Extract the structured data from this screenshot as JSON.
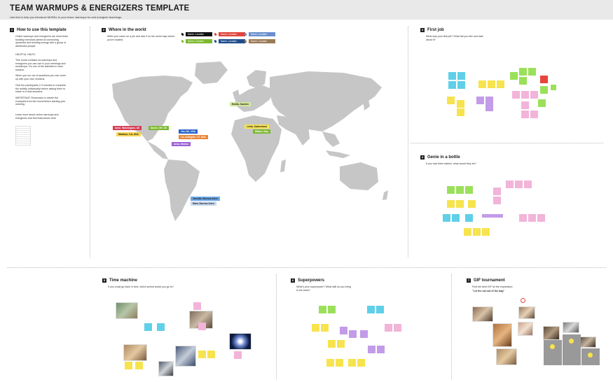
{
  "header": {
    "title": "TEAM WARMUPS & ENERGIZERS TEMPLATE",
    "subtitle": "Use this to help you introduce MURAL to your team: warmups for and energizer teachings."
  },
  "how_to": {
    "num": "1",
    "title": "How to use this template",
    "p1": "Online warmups and energizers are short team building exercises aimed at connecting dynamics and building energy with a group of distributed people.",
    "hints_title": "HELPFUL HINTS:",
    "p2": "This mural contains six warmups and energizers you can use in your meetings and workshops. Do one of the activities in each session.",
    "p3": "When you run out of questions you can come up with your own versions.",
    "p4": "Give the participants 2-3 minutes to complete the activity individually before asking them to share in a final sessions.",
    "p5": "IMPORTANT: Remember to delete the examples from the mural before starting your meeting.",
    "p6": "Learn more about online warmups and energizers and find instructions here"
  },
  "world": {
    "num": "2",
    "title": "Where in the world",
    "desc": "Write your name on a pin and add it on the world map where you're located.",
    "legend": [
      {
        "label": "Name, Location",
        "color": "#111111"
      },
      {
        "label": "Name, Location",
        "color": "#e0463e"
      },
      {
        "label": "Name, Location",
        "color": "#6a8fce"
      },
      {
        "label": "Name, Location",
        "color": "#7cb82f"
      },
      {
        "label": "Name, Location",
        "color": "#1f4e8c"
      },
      {
        "label": "Name, Location",
        "color": "#9b7a57"
      }
    ],
    "pins": [
      {
        "label": "Emilia, Sweden",
        "color": "#d4e89a",
        "text_color": "#222"
      },
      {
        "label": "Anne, Washington, US",
        "color": "#d63a52",
        "text_color": "#fff"
      },
      {
        "label": "Madison, CA, USA",
        "color": "#f7d64e",
        "text_color": "#222"
      },
      {
        "label": "Daniel, OR, US",
        "color": "#7cb82f",
        "text_color": "#fff"
      },
      {
        "label": "Jim, NC, USA",
        "color": "#2b63c9",
        "text_color": "#fff"
      },
      {
        "label": "Liz, Arlington, TX, USA",
        "color": "#e8873a",
        "text_color": "#fff"
      },
      {
        "label": "Anna, Mexico",
        "color": "#9a62d6",
        "text_color": "#fff"
      },
      {
        "label": "Linda, Switzerland",
        "color": "#f7e34e",
        "text_color": "#222"
      },
      {
        "label": "Milano, Italy",
        "color": "#7cb82f",
        "text_color": "#fff"
      },
      {
        "label": "Jennifer, Buenos Aires",
        "color": "#6aa7e6",
        "text_color": "#222"
      },
      {
        "label": "Mark, Buenos Aires",
        "color": "#c8d9ef",
        "text_color": "#222"
      }
    ]
  },
  "first_job": {
    "num": "3",
    "title": "First job",
    "desc": "What was your first job? What did you like and hate about it?"
  },
  "genie": {
    "num": "4",
    "title": "Genie in a bottle",
    "desc": "If you had three wishes, what would they be?"
  },
  "time_machine": {
    "num": "5",
    "title": "Time machine",
    "desc": "If you could go back in time, which period would you go to?"
  },
  "superpowers": {
    "num": "6",
    "title": "Superpowers",
    "desc": "What's your superpower? What skill do you bring to the team?"
  },
  "gif": {
    "num": "7",
    "title": "GIF tournament",
    "desc": "Find the best GIF for the expression:",
    "quote": "\"Let the cat out of the bag\""
  },
  "colors": {
    "yellow": "#f7e34e",
    "cyan": "#5fd0e8",
    "green": "#9be05a",
    "pink": "#f2b4d8",
    "purple": "#c39be8",
    "orange": "#f5b14a",
    "red": "#e8453c",
    "map": "#c6c6c6"
  }
}
